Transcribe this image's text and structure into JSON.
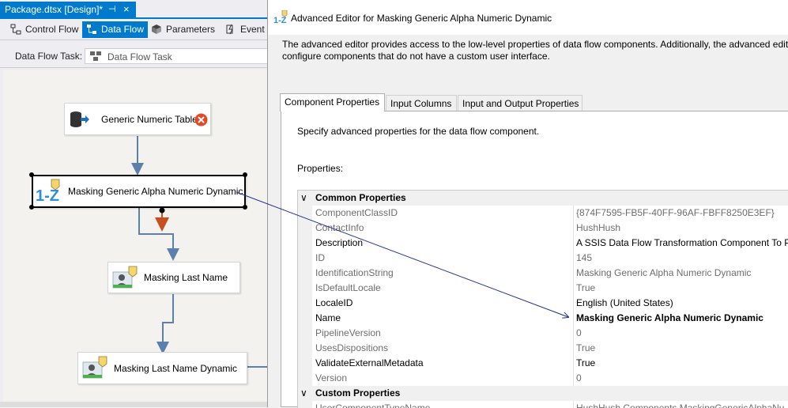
{
  "document_tab": {
    "title": "Package.dtsx [Design]*",
    "pin_glyph": "⊣",
    "close_glyph": "×"
  },
  "designer_tabs": [
    {
      "label": "Control Flow",
      "icon": "control-flow-icon",
      "active": false
    },
    {
      "label": "Data Flow",
      "icon": "data-flow-icon",
      "active": true
    },
    {
      "label": "Parameters",
      "icon": "parameters-icon",
      "active": false
    },
    {
      "label": "Event H",
      "icon": "event-handlers-icon",
      "active": false
    }
  ],
  "data_flow_task": {
    "label": "Data Flow Task:",
    "value": "Data Flow Task"
  },
  "canvas_nodes": {
    "source": {
      "label": "Generic Numeric Table",
      "icon": "database-source-icon",
      "status": "error-icon"
    },
    "selected": {
      "label": "Masking Generic Alpha Numeric Dynamic",
      "icon": "masking-alpha-icon"
    },
    "last_name": {
      "label": "Masking Last Name",
      "icon": "masking-user-icon"
    },
    "last_name_dynamic": {
      "label": "Masking Last Name Dynamic",
      "icon": "masking-user-icon"
    }
  },
  "editor": {
    "title": "Advanced Editor for Masking Generic Alpha Numeric Dynamic",
    "description_line1": "The advanced editor provides access to the low-level properties of data flow components. Additionally, the advanced edit",
    "description_line2": "configure components that do not have a custom user interface.",
    "tabs": [
      {
        "label": "Component Properties",
        "active": true
      },
      {
        "label": "Input Columns",
        "active": false
      },
      {
        "label": "Input and Output Properties",
        "active": false
      }
    ],
    "page_hint": "Specify advanced properties for the data flow component.",
    "properties_label": "Properties:"
  },
  "property_grid": {
    "categories": {
      "common": "Common Properties",
      "custom": "Custom Properties"
    },
    "common_rows": [
      {
        "name": "ComponentClassID",
        "value": "{874F7595-FB5F-40FF-96AF-FBFF8250E3EF}",
        "readonly": true,
        "bold": false
      },
      {
        "name": "ContactInfo",
        "value": "HushHush",
        "readonly": true,
        "bold": false
      },
      {
        "name": "Description",
        "value": "A SSIS Data Flow Transformation Component To Pr",
        "readonly": false,
        "bold": false
      },
      {
        "name": "ID",
        "value": "145",
        "readonly": true,
        "bold": false
      },
      {
        "name": "IdentificationString",
        "value": "Masking Generic Alpha Numeric Dynamic",
        "readonly": true,
        "bold": false
      },
      {
        "name": "IsDefaultLocale",
        "value": "True",
        "readonly": true,
        "bold": false
      },
      {
        "name": "LocaleID",
        "value": "English (United States)",
        "readonly": false,
        "bold": false
      },
      {
        "name": "Name",
        "value": "Masking Generic Alpha Numeric Dynamic",
        "readonly": false,
        "bold": true
      },
      {
        "name": "PipelineVersion",
        "value": "0",
        "readonly": true,
        "bold": false
      },
      {
        "name": "UsesDispositions",
        "value": "True",
        "readonly": true,
        "bold": false
      },
      {
        "name": "ValidateExternalMetadata",
        "value": "True",
        "readonly": false,
        "bold": false
      },
      {
        "name": "Version",
        "value": "0",
        "readonly": true,
        "bold": false
      }
    ],
    "custom_rows": [
      {
        "name": "UserComponentTypeName",
        "value": "HushHush.Components.MaskingGenericAlphaNu",
        "readonly": true,
        "bold": false
      }
    ]
  },
  "colors": {
    "accent_blue": "#007acc",
    "error_red": "#e04a2a",
    "flow_arrow": "#5d7fae",
    "error_arrow": "#c8501e",
    "callout_line": "#1f2f8f"
  }
}
